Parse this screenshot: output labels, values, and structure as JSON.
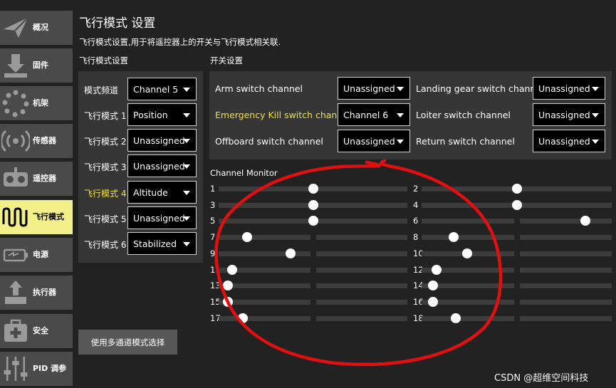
{
  "sidebar": {
    "items": [
      {
        "label": "概况",
        "icon": "paper-plane-icon",
        "active": false
      },
      {
        "label": "固件",
        "icon": "download-icon",
        "active": false
      },
      {
        "label": "机架",
        "icon": "airframe-icon",
        "active": false
      },
      {
        "label": "传感器",
        "icon": "radio-waves-icon",
        "active": false
      },
      {
        "label": "遥控器",
        "icon": "remote-control-icon",
        "active": false
      },
      {
        "label": "飞行模式",
        "icon": "flight-modes-icon",
        "active": true
      },
      {
        "label": "电源",
        "icon": "battery-icon",
        "active": false
      },
      {
        "label": "执行器",
        "icon": "actuator-icon",
        "active": false
      },
      {
        "label": "安全",
        "icon": "first-aid-icon",
        "active": false
      },
      {
        "label": "PID 调参",
        "icon": "sliders-icon",
        "active": false
      }
    ]
  },
  "header": {
    "title": "飞行模式 设置",
    "subtitle": "飞行模式设置,用于将遥控器上的开关与飞行模式相关联."
  },
  "flight_modes": {
    "section_label": "飞行模式设置",
    "rows": [
      {
        "label": "模式频道",
        "value": "Channel 5",
        "highlight": false
      },
      {
        "label": "飞行模式 1",
        "value": "Position",
        "highlight": false
      },
      {
        "label": "飞行模式 2",
        "value": "Unassigned",
        "highlight": false
      },
      {
        "label": "飞行模式 3",
        "value": "Unassigned",
        "highlight": false
      },
      {
        "label": "飞行模式 4",
        "value": "Altitude",
        "highlight": true
      },
      {
        "label": "飞行模式 5",
        "value": "Unassigned",
        "highlight": false
      },
      {
        "label": "飞行模式 6",
        "value": "Stabilized",
        "highlight": false
      }
    ],
    "multi_channel_button": "使用多通道模式选择"
  },
  "switches": {
    "section_label": "开关设置",
    "rows": [
      {
        "label": "Arm switch channel",
        "value": "Unassigned",
        "highlight": false
      },
      {
        "label": "Landing gear switch channel",
        "value": "Unassigned",
        "highlight": false
      },
      {
        "label": "Emergency Kill switch channel",
        "value": "Channel 6",
        "highlight": true
      },
      {
        "label": "Loiter switch channel",
        "value": "Unassigned",
        "highlight": false
      },
      {
        "label": "Offboard switch channel",
        "value": "Unassigned",
        "highlight": false
      },
      {
        "label": "Return switch channel",
        "value": "Unassigned",
        "highlight": false
      }
    ]
  },
  "channel_monitor": {
    "label": "Channel Monitor",
    "channels": [
      {
        "num": "1",
        "level": 0.5
      },
      {
        "num": "2",
        "level": 0.5
      },
      {
        "num": "3",
        "level": 0.5
      },
      {
        "num": "4",
        "level": 0.5
      },
      {
        "num": "5",
        "level": 0.5
      },
      {
        "num": "6",
        "level": 0.86
      },
      {
        "num": "7",
        "level": 0.15
      },
      {
        "num": "8",
        "level": 0.17
      },
      {
        "num": "9",
        "level": 0.38
      },
      {
        "num": "10",
        "level": 0.24
      },
      {
        "num": "11",
        "level": 0.07
      },
      {
        "num": "12",
        "level": 0.08
      },
      {
        "num": "13",
        "level": 0.05
      },
      {
        "num": "14",
        "level": 0.06
      },
      {
        "num": "15",
        "level": 0.05
      },
      {
        "num": "16",
        "level": 0.06
      },
      {
        "num": "17",
        "level": 0.13
      },
      {
        "num": "18",
        "level": 0.18
      }
    ]
  },
  "watermark": "CSDN @超维空间科技",
  "colors": {
    "highlight_text": "#f0e040",
    "active_sidebar": "#f3f089",
    "annotation": "#e01010"
  }
}
